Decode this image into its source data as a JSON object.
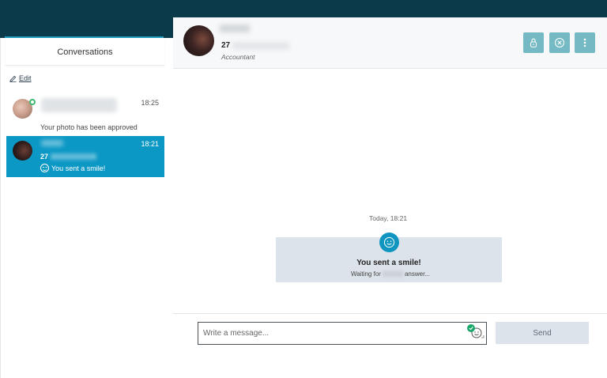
{
  "sidebar": {
    "tab_label": "Conversations",
    "edit_label": "Edit",
    "conversations": [
      {
        "time": "18:25",
        "preview": "Your photo has been approved"
      },
      {
        "age": "27",
        "time": "18:21",
        "preview": "You sent a smile!"
      }
    ]
  },
  "header": {
    "age": "27",
    "job": "Accountant"
  },
  "thread": {
    "date_label": "Today, 18:21",
    "system_title": "You sent a smile!",
    "system_sub_prefix": "Waiting for",
    "system_sub_suffix": "answer..."
  },
  "composer": {
    "placeholder": "Write a message...",
    "send_label": "Send"
  },
  "colors": {
    "topbar": "#0b3a4a",
    "accent": "#0c98c5",
    "header_button": "#74b9c4",
    "online": "#3cba6d",
    "emoji_badge": "#1aa86a"
  },
  "icons": [
    "pencil-icon",
    "lock-icon",
    "block-icon",
    "more-vertical-icon",
    "smile-icon",
    "emoji-icon",
    "check-badge-icon"
  ]
}
